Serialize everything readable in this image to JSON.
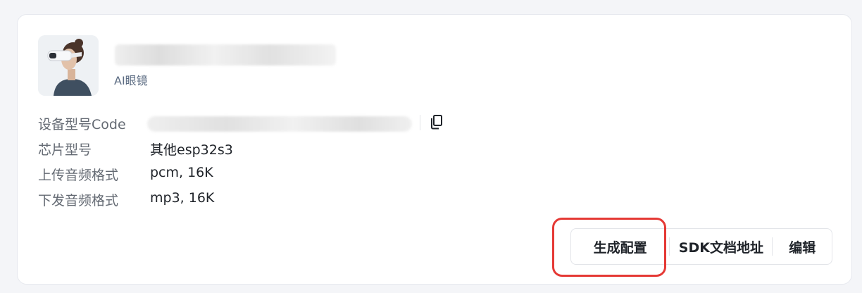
{
  "device": {
    "category": "AI眼镜",
    "avatar_icon": "person-with-vr-glasses-photo"
  },
  "details": {
    "code_label": "设备型号Code",
    "chip_label": "芯片型号",
    "chip_value": "其他esp32s3",
    "upload_label": "上传音频格式",
    "upload_value": "pcm, 16K",
    "download_label": "下发音频格式",
    "download_value": "mp3, 16K",
    "copy_icon": "copy-icon"
  },
  "actions": {
    "generate": "生成配置",
    "sdk": "SDK文档地址",
    "edit": "编辑"
  },
  "colors": {
    "highlight": "#e53935",
    "category_text": "#5b6b82"
  }
}
